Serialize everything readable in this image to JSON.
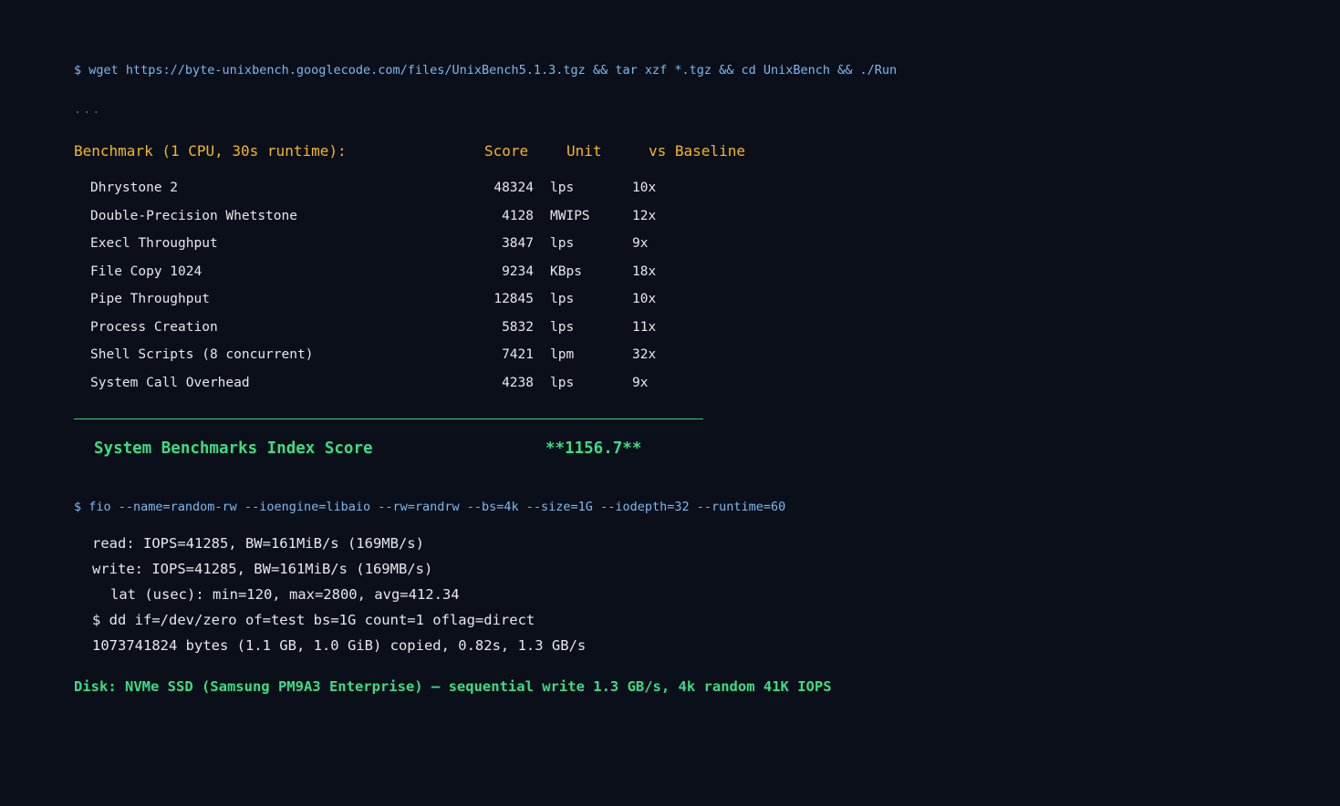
{
  "commands": {
    "unixbench": "$ wget https://byte-unixbench.googlecode.com/files/UnixBench5.1.3.tgz && tar xzf *.tgz && cd UnixBench && ./Run",
    "fio": "$ fio --name=random-rw --ioengine=libaio --rw=randrw --bs=4k --size=1G --iodepth=32 --runtime=60"
  },
  "ellipsis": "...",
  "benchmark": {
    "header": {
      "title": "Benchmark (1 CPU, 30s runtime):",
      "score": "Score",
      "unit": "Unit",
      "baseline": "vs Baseline"
    },
    "rows": [
      {
        "name": "Dhrystone 2",
        "score": "48324",
        "unit": "lps",
        "ratio": "10x"
      },
      {
        "name": "Double-Precision Whetstone",
        "score": "4128",
        "unit": "MWIPS",
        "ratio": "12x"
      },
      {
        "name": "Execl Throughput",
        "score": "3847",
        "unit": "lps",
        "ratio": "9x"
      },
      {
        "name": "File Copy 1024",
        "score": "9234",
        "unit": "KBps",
        "ratio": "18x"
      },
      {
        "name": "Pipe Throughput",
        "score": "12845",
        "unit": "lps",
        "ratio": "10x"
      },
      {
        "name": "Process Creation",
        "score": "5832",
        "unit": "lps",
        "ratio": "11x"
      },
      {
        "name": "Shell Scripts (8 concurrent)",
        "score": "7421",
        "unit": "lpm",
        "ratio": "32x"
      },
      {
        "name": "System Call Overhead",
        "score": "4238",
        "unit": "lps",
        "ratio": "9x"
      }
    ],
    "index": {
      "label": "System Benchmarks Index Score",
      "value": "**1156.7**"
    }
  },
  "fio_output": [
    "read: IOPS=41285, BW=161MiB/s (169MB/s)",
    "write: IOPS=41285, BW=161MiB/s (169MB/s)",
    "lat (usec): min=120, max=2800, avg=412.34",
    "$ dd if=/dev/zero of=test bs=1G count=1 oflag=direct",
    "1073741824 bytes (1.1 GB, 1.0 GiB) copied, 0.82s, 1.3 GB/s"
  ],
  "disk_summary": "Disk: NVMe SSD (Samsung PM9A3 Enterprise) — sequential write 1.3 GB/s, 4k random 41K IOPS",
  "colors": {
    "background": "#0a0f1a",
    "command": "#7fb8ee",
    "header": "#f5b820",
    "text": "#e6e8ec",
    "accent": "#3ddc84"
  }
}
